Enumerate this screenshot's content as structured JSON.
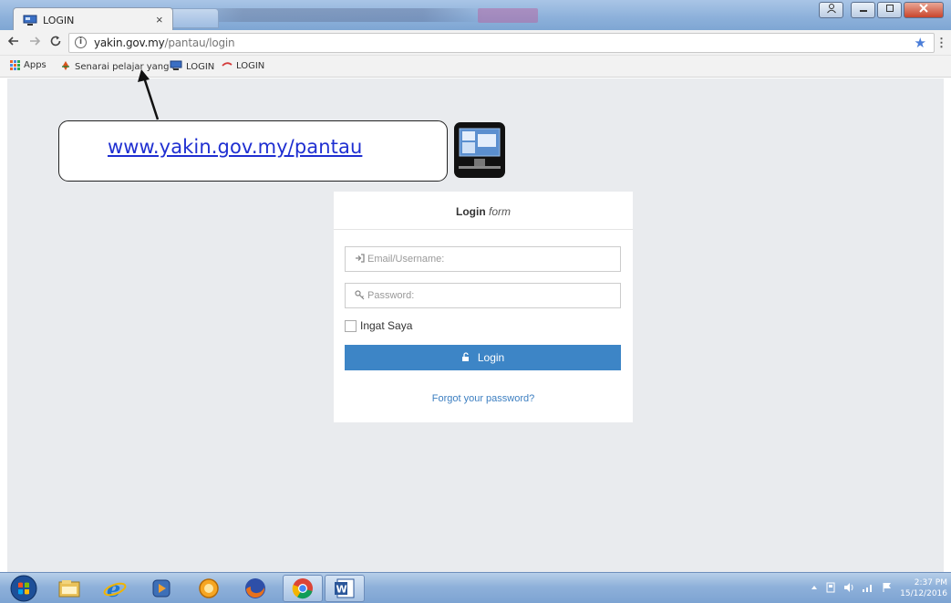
{
  "browser": {
    "tab_title": "LOGIN",
    "tab_close": "×",
    "url_domain": "yakin.gov.my",
    "url_path": "/pantau/login",
    "bookmarks": {
      "apps": "Apps",
      "item1": "Senarai pelajar yang l",
      "item2": "LOGIN",
      "item3": "LOGIN"
    }
  },
  "login_form": {
    "title_bold": "Login",
    "title_italic": "form",
    "email_placeholder": "Email/Username:",
    "password_placeholder": "Password:",
    "remember_label": "Ingat Saya",
    "login_button": "Login",
    "forgot_link": "Forgot your password?"
  },
  "annotation": {
    "callout_text": "www.yakin.gov.my/pantau"
  },
  "taskbar": {
    "time": "2:37 PM",
    "date": "15/12/2016"
  },
  "colors": {
    "page_bg": "#e9ebee",
    "button_blue": "#3d85c6",
    "link_blue": "#3d7fc1",
    "callout_link": "#1f2fd1"
  }
}
